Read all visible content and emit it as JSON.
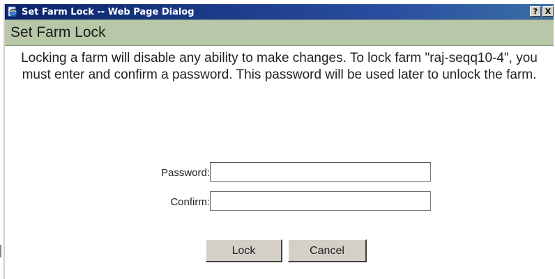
{
  "window": {
    "title": "Set Farm Lock -- Web Page Dialog",
    "help_button": "?",
    "close_button": "X",
    "app_icon": "ie-page-icon"
  },
  "header": {
    "title": "Set Farm Lock"
  },
  "message": {
    "text": "Locking a farm will disable any ability to make changes. To lock farm \"raj-seqq10-4\", you must enter and confirm a password. This password will be used later to unlock the farm."
  },
  "form": {
    "password_label": "Password:",
    "password_value": "",
    "confirm_label": "Confirm:",
    "confirm_value": ""
  },
  "buttons": {
    "lock": "Lock",
    "cancel": "Cancel"
  },
  "colors": {
    "titlebar": "#0a246a",
    "header_band": "#b8c7a8",
    "button_face": "#d4d0c8"
  }
}
